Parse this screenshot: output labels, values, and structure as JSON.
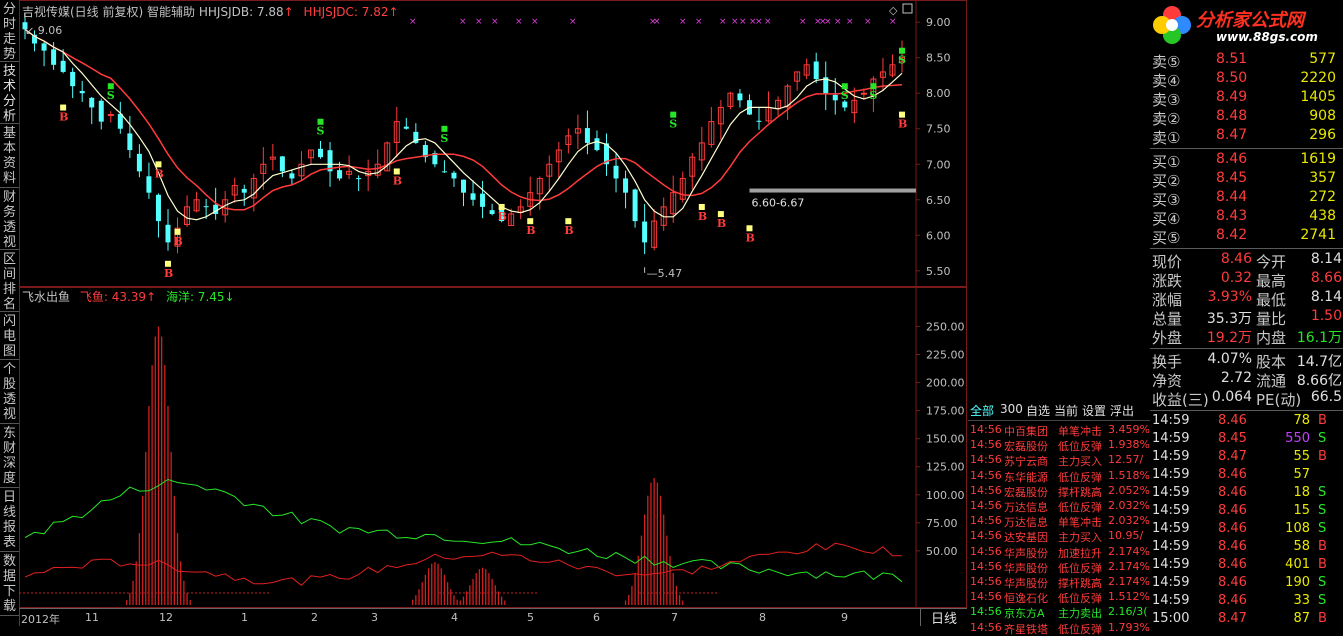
{
  "left_tabs": [
    "分时走势",
    "技术分析",
    "基本资料",
    "财务透视",
    "区间排名",
    "闪电图",
    "个股透视",
    "东财深度",
    "日线报表",
    "数据下载"
  ],
  "kline_title": {
    "name": "吉视传媒(日线 前复权)",
    "helper": "智能辅助",
    "ind1_label": "HHJSJDB: 7.88",
    "ind1_arrow": "↑",
    "ind2_label": "HHJSJDC: 7.82",
    "ind2_arrow": "↑"
  },
  "price_axis": [
    "9.00",
    "8.50",
    "8.00",
    "7.50",
    "7.00",
    "6.50",
    "6.00",
    "5.50"
  ],
  "kline_annotations": {
    "high_label": "9.06",
    "low_label": "5.47",
    "range_label": "6.60-6.67"
  },
  "indicator_title": {
    "name": "飞水出鱼",
    "fish_label": "飞鱼: 43.39",
    "fish_arrow": "↑",
    "ocean_label": "海洋: 7.45",
    "ocean_arrow": "↓"
  },
  "indicator_axis": [
    "250.00",
    "225.00",
    "200.00",
    "175.00",
    "150.00",
    "125.00",
    "100.00",
    "75.00",
    "50.00"
  ],
  "x_axis": [
    "2012年",
    "11",
    "12",
    "1",
    "2",
    "3",
    "4",
    "5",
    "6",
    "7",
    "8",
    "9"
  ],
  "period_label": "日线",
  "logo": {
    "title": "分析家公式网",
    "url": "www.88gs.com"
  },
  "order_book": {
    "sell": [
      {
        "label": "卖⑤",
        "price": "8.51",
        "vol": "577"
      },
      {
        "label": "卖④",
        "price": "8.50",
        "vol": "2220"
      },
      {
        "label": "卖③",
        "price": "8.49",
        "vol": "1405"
      },
      {
        "label": "卖②",
        "price": "8.48",
        "vol": "908"
      },
      {
        "label": "卖①",
        "price": "8.47",
        "vol": "296"
      }
    ],
    "buy": [
      {
        "label": "买①",
        "price": "8.46",
        "vol": "1619"
      },
      {
        "label": "买②",
        "price": "8.45",
        "vol": "357"
      },
      {
        "label": "买③",
        "price": "8.44",
        "vol": "272"
      },
      {
        "label": "买④",
        "price": "8.43",
        "vol": "438"
      },
      {
        "label": "买⑤",
        "price": "8.42",
        "vol": "2741"
      }
    ]
  },
  "quote": [
    {
      "l1": "现价",
      "v1": "8.46",
      "c1": "red",
      "l2": "今开",
      "v2": "8.14",
      "c2": "white"
    },
    {
      "l1": "涨跌",
      "v1": "0.32",
      "c1": "red",
      "l2": "最高",
      "v2": "8.66",
      "c2": "red"
    },
    {
      "l1": "涨幅",
      "v1": "3.93%",
      "c1": "red",
      "l2": "最低",
      "v2": "8.14",
      "c2": "white"
    },
    {
      "l1": "总量",
      "v1": "35.3万",
      "c1": "white",
      "l2": "量比",
      "v2": "1.50",
      "c2": "red"
    },
    {
      "l1": "外盘",
      "v1": "19.2万",
      "c1": "red",
      "l2": "内盘",
      "v2": "16.1万",
      "c2": "green"
    }
  ],
  "fundamentals": [
    {
      "l1": "换手",
      "v1": "4.07%",
      "l2": "股本",
      "v2": "14.7亿"
    },
    {
      "l1": "净资",
      "v1": "2.72",
      "l2": "流通",
      "v2": "8.66亿"
    },
    {
      "l1": "收益(三)",
      "v1": "0.064",
      "l2": "PE(动)",
      "v2": "66.5"
    }
  ],
  "news_tabs": [
    "全部",
    "300",
    "自选",
    "当前",
    "设置",
    "浮出"
  ],
  "news": [
    {
      "time": "14:56",
      "name": "中百集团",
      "action": "单笔冲击",
      "pct": "3.459%",
      "color": "red"
    },
    {
      "time": "14:56",
      "name": "宏磊股份",
      "action": "低位反弹",
      "pct": "1.938%",
      "color": "red"
    },
    {
      "time": "14:56",
      "name": "苏宁云商",
      "action": "主力买入",
      "pct": "12.57/",
      "color": "red"
    },
    {
      "time": "14:56",
      "name": "东华能源",
      "action": "低位反弹",
      "pct": "1.518%",
      "color": "red"
    },
    {
      "time": "14:56",
      "name": "宏磊股份",
      "action": "撑杆跳高",
      "pct": "2.052%",
      "color": "red"
    },
    {
      "time": "14:56",
      "name": "万达信息",
      "action": "低位反弹",
      "pct": "2.032%",
      "color": "red"
    },
    {
      "time": "14:56",
      "name": "万达信息",
      "action": "单笔冲击",
      "pct": "2.032%",
      "color": "red"
    },
    {
      "time": "14:56",
      "name": "达安基因",
      "action": "主力买入",
      "pct": "10.95/",
      "color": "red"
    },
    {
      "time": "14:56",
      "name": "华声股份",
      "action": "加速拉升",
      "pct": "2.174%",
      "color": "red"
    },
    {
      "time": "14:56",
      "name": "华声股份",
      "action": "低位反弹",
      "pct": "2.174%",
      "color": "red"
    },
    {
      "time": "14:56",
      "name": "华声股份",
      "action": "撑杆跳高",
      "pct": "2.174%",
      "color": "red"
    },
    {
      "time": "14:56",
      "name": "恒逸石化",
      "action": "低位反弹",
      "pct": "1.512%",
      "color": "red"
    },
    {
      "time": "14:56",
      "name": "京东方A",
      "action": "主力卖出",
      "pct": "2.16/3(",
      "color": "green"
    },
    {
      "time": "14:56",
      "name": "齐星铁塔",
      "action": "低位反弹",
      "pct": "1.793%",
      "color": "red"
    }
  ],
  "trades": [
    {
      "time": "14:59",
      "price": "8.46",
      "pc": "red",
      "vol": "78",
      "vc": "yellow",
      "bs": "B",
      "bc": "red"
    },
    {
      "time": "14:59",
      "price": "8.45",
      "pc": "red",
      "vol": "550",
      "vc": "purple",
      "bs": "S",
      "bc": "green"
    },
    {
      "time": "14:59",
      "price": "8.47",
      "pc": "red",
      "vol": "55",
      "vc": "yellow",
      "bs": "B",
      "bc": "red"
    },
    {
      "time": "14:59",
      "price": "8.46",
      "pc": "red",
      "vol": "57",
      "vc": "yellow",
      "bs": "",
      "bc": "red"
    },
    {
      "time": "14:59",
      "price": "8.46",
      "pc": "red",
      "vol": "18",
      "vc": "yellow",
      "bs": "S",
      "bc": "green"
    },
    {
      "time": "14:59",
      "price": "8.46",
      "pc": "red",
      "vol": "15",
      "vc": "yellow",
      "bs": "S",
      "bc": "green"
    },
    {
      "time": "14:59",
      "price": "8.46",
      "pc": "red",
      "vol": "108",
      "vc": "yellow",
      "bs": "S",
      "bc": "green"
    },
    {
      "time": "14:59",
      "price": "8.46",
      "pc": "red",
      "vol": "58",
      "vc": "yellow",
      "bs": "B",
      "bc": "red"
    },
    {
      "time": "14:59",
      "price": "8.46",
      "pc": "red",
      "vol": "401",
      "vc": "yellow",
      "bs": "B",
      "bc": "red"
    },
    {
      "time": "14:59",
      "price": "8.46",
      "pc": "red",
      "vol": "190",
      "vc": "yellow",
      "bs": "S",
      "bc": "green"
    },
    {
      "time": "14:59",
      "price": "8.46",
      "pc": "red",
      "vol": "33",
      "vc": "yellow",
      "bs": "S",
      "bc": "green"
    },
    {
      "time": "15:00",
      "price": "8.47",
      "pc": "red",
      "vol": "87",
      "vc": "yellow",
      "bs": "B",
      "bc": "red"
    }
  ],
  "chart_data": {
    "type": "candlestick-with-indicator",
    "ylim_price": [
      5.3,
      9.2
    ],
    "ylim_indicator": [
      0,
      270
    ],
    "closes": [
      8.9,
      8.7,
      8.6,
      8.4,
      8.3,
      8.1,
      8.0,
      7.8,
      7.6,
      7.7,
      7.5,
      7.2,
      6.9,
      6.6,
      6.2,
      5.9,
      6.1,
      6.4,
      6.5,
      6.4,
      6.3,
      6.5,
      6.7,
      6.6,
      6.8,
      7.0,
      7.1,
      6.9,
      6.8,
      7.0,
      7.2,
      7.1,
      6.9,
      6.8,
      6.9,
      6.8,
      6.9,
      7.0,
      7.3,
      7.6,
      7.5,
      7.3,
      7.1,
      7.0,
      6.9,
      6.8,
      6.6,
      6.5,
      6.4,
      6.3,
      6.2,
      6.3,
      6.4,
      6.6,
      6.8,
      7.0,
      7.2,
      7.4,
      7.5,
      7.3,
      7.2,
      7.0,
      6.8,
      6.6,
      6.2,
      5.9,
      6.2,
      6.4,
      6.6,
      6.8,
      7.1,
      7.3,
      7.6,
      7.8,
      8.0,
      7.9,
      7.7,
      7.6,
      7.8,
      7.9,
      8.1,
      8.3,
      8.4,
      8.2,
      8.0,
      7.9,
      7.8,
      7.9,
      8.0,
      8.2,
      8.3,
      8.4,
      8.5
    ],
    "fish_peaks": [
      {
        "index": 14,
        "value": 250
      },
      {
        "index": 66,
        "value": 115
      },
      {
        "index": 43,
        "value": 40
      },
      {
        "index": 48,
        "value": 35
      }
    ],
    "signals": [
      {
        "type": "B",
        "index": 4,
        "price": 7.7
      },
      {
        "type": "S",
        "index": 9,
        "price": 8.0
      },
      {
        "type": "B",
        "index": 14,
        "price": 6.9
      },
      {
        "type": "B",
        "index": 16,
        "price": 5.95
      },
      {
        "type": "B",
        "index": 15,
        "price": 5.5
      },
      {
        "type": "S",
        "index": 31,
        "price": 7.5
      },
      {
        "type": "B",
        "index": 39,
        "price": 6.8
      },
      {
        "type": "S",
        "index": 44,
        "price": 7.4
      },
      {
        "type": "B",
        "index": 50,
        "price": 6.3
      },
      {
        "type": "B",
        "index": 53,
        "price": 6.1
      },
      {
        "type": "B",
        "index": 57,
        "price": 6.1
      },
      {
        "type": "S",
        "index": 68,
        "price": 7.6
      },
      {
        "type": "B",
        "index": 71,
        "price": 6.3
      },
      {
        "type": "B",
        "index": 73,
        "price": 6.2
      },
      {
        "type": "B",
        "index": 76,
        "price": 6.0
      },
      {
        "type": "S",
        "index": 86,
        "price": 8.0
      },
      {
        "type": "S",
        "index": 89,
        "price": 8.0
      },
      {
        "type": "B",
        "index": 100,
        "price": 7.6
      },
      {
        "type": "S",
        "index": 108,
        "price": 8.5
      }
    ]
  }
}
